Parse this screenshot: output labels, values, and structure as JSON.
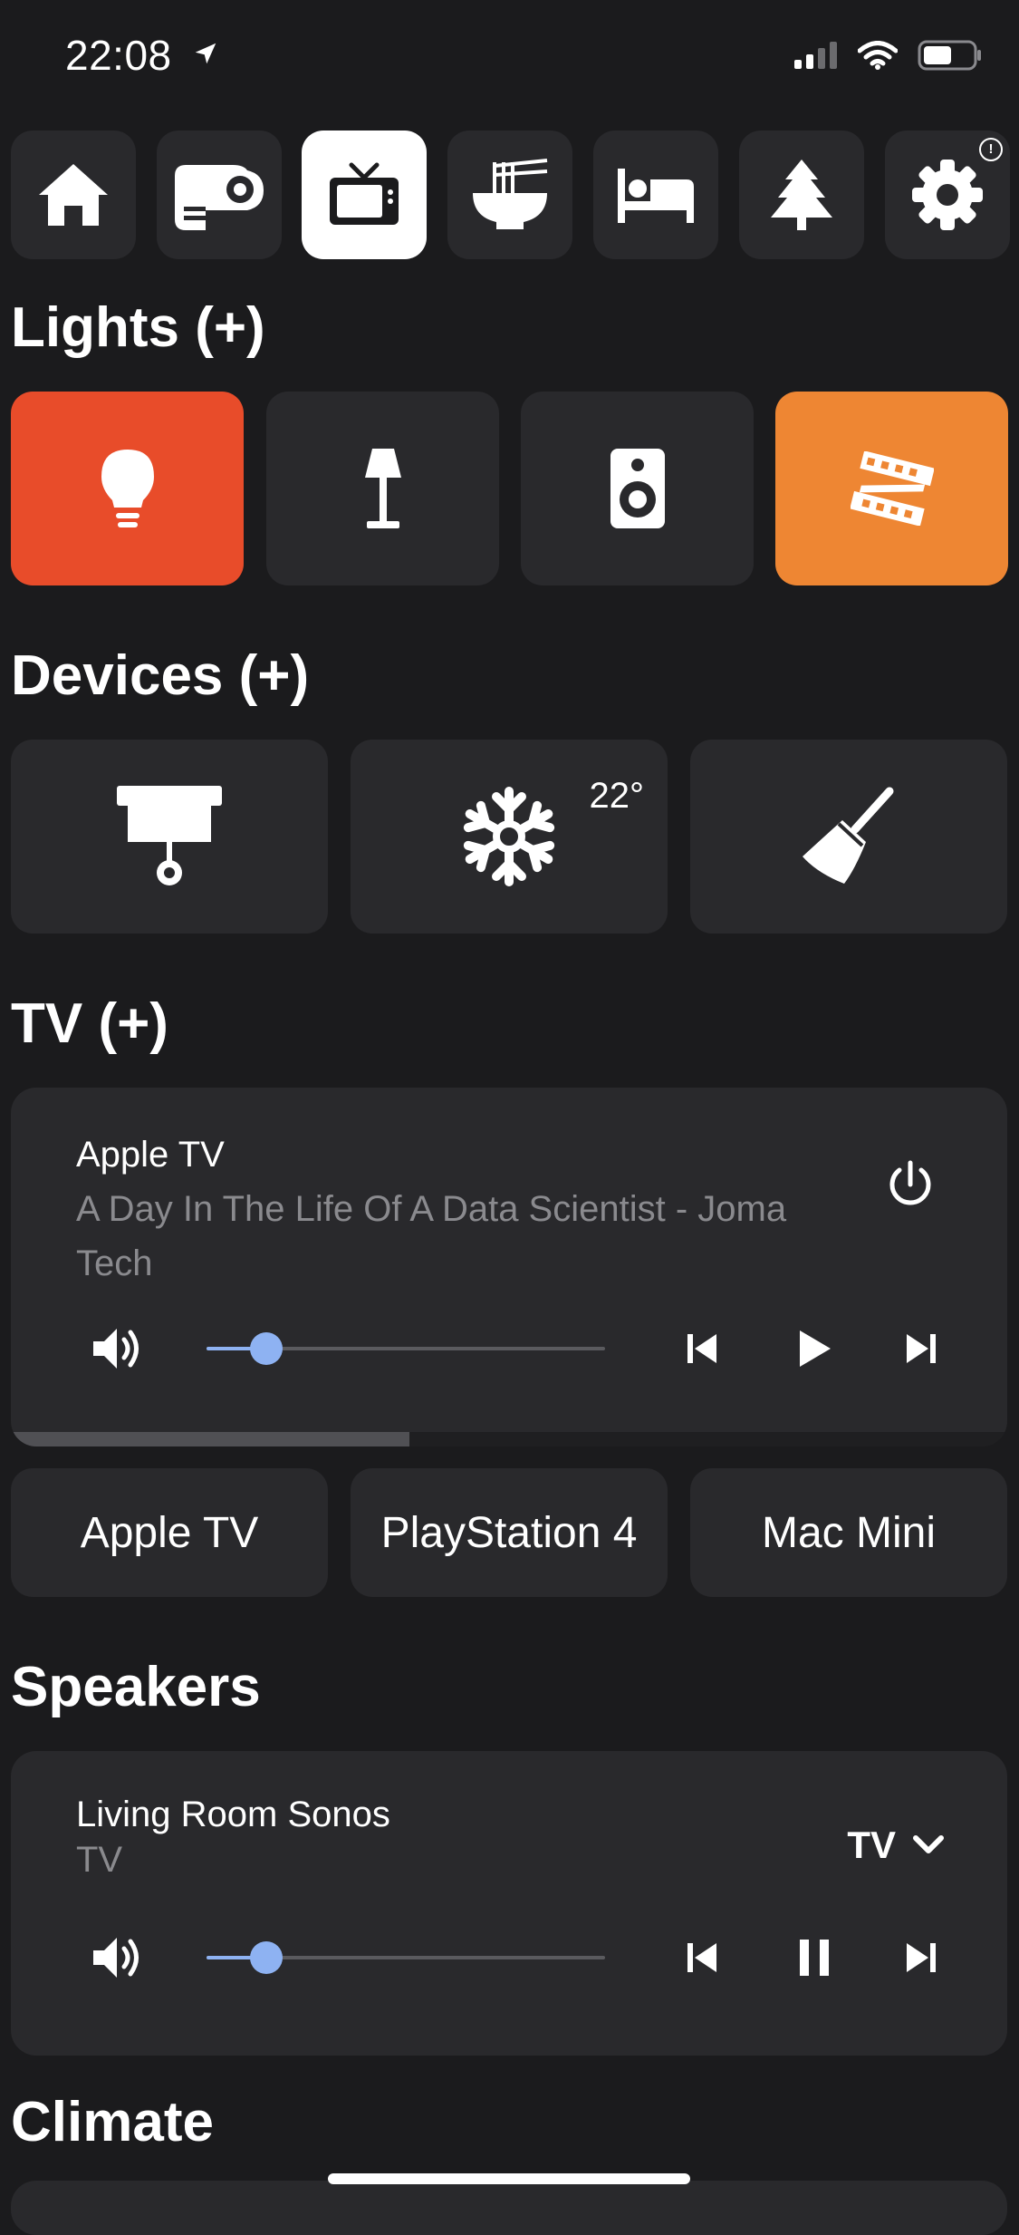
{
  "status_bar": {
    "time": "22:08",
    "icons": [
      "location-arrow-icon",
      "signal-icon",
      "wifi-icon",
      "battery-icon"
    ]
  },
  "rooms": [
    {
      "name": "home-icon",
      "active": false
    },
    {
      "name": "projector-icon",
      "active": false
    },
    {
      "name": "tv-icon",
      "active": true
    },
    {
      "name": "noodle-bowl-icon",
      "active": false
    },
    {
      "name": "bed-icon",
      "active": false
    },
    {
      "name": "pine-tree-icon",
      "active": false
    },
    {
      "name": "gear-icon",
      "active": false,
      "badge": "!"
    }
  ],
  "lights": {
    "title": "Lights (+)",
    "tiles": [
      {
        "icon": "lightbulb-icon",
        "state": "on",
        "color": "#e84c2a"
      },
      {
        "icon": "floor-lamp-icon",
        "state": "off"
      },
      {
        "icon": "speaker-icon",
        "state": "off"
      },
      {
        "icon": "led-strip-icon",
        "state": "on",
        "color": "#ee8633"
      }
    ]
  },
  "devices": {
    "title": "Devices (+)",
    "tiles": [
      {
        "icon": "projector-screen-icon"
      },
      {
        "icon": "snowflake-icon",
        "value": "22°"
      },
      {
        "icon": "broom-icon"
      }
    ]
  },
  "tv": {
    "title": "TV (+)",
    "player": {
      "name": "Apple TV",
      "media": "A Day In The Life Of A Data Scientist - Joma Tech",
      "volume": 0.15,
      "progress": 0.4,
      "controls": [
        "volume-icon",
        "previous-track-icon",
        "play-icon",
        "next-track-icon",
        "power-icon"
      ]
    },
    "sources": [
      "Apple TV",
      "PlayStation 4",
      "Mac Mini"
    ]
  },
  "speakers": {
    "title": "Speakers",
    "player": {
      "name": "Living Room Sonos",
      "source": "TV",
      "selected_source": "TV",
      "volume": 0.15,
      "controls": [
        "volume-icon",
        "previous-track-icon",
        "pause-icon",
        "next-track-icon"
      ]
    }
  },
  "climate": {
    "title": "Climate"
  },
  "colors": {
    "background": "#1b1b1d",
    "tile": "#29292c",
    "accent_blue": "#8eb2f2",
    "on_red": "#e84c2a",
    "on_orange": "#ee8633"
  }
}
